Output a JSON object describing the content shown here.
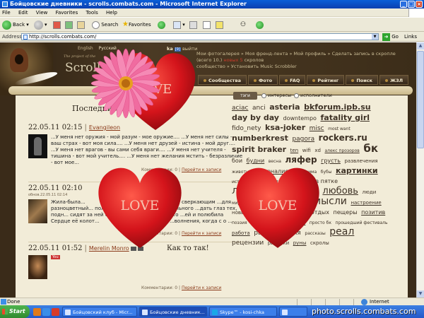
{
  "window": {
    "title": "Бойцовские дневники - scrolls.combats.com - Microsoft Internet Explorer"
  },
  "menu": [
    "File",
    "Edit",
    "View",
    "Favorites",
    "Tools",
    "Help"
  ],
  "toolbar": {
    "back": "Back",
    "search": "Search",
    "favorites": "Favorites"
  },
  "address": {
    "label": "Address",
    "url": "http://scrolls.combats.com/",
    "go": "Go",
    "links": "Links"
  },
  "site": {
    "langs": {
      "en": "English",
      "ru": "Русский"
    },
    "tagline": "The project of the",
    "title": "Scrolls",
    "user": {
      "name": "ka",
      "badge": "[9]",
      "action": "выйти"
    },
    "nav_line1": "Мои фотогалерея » Моя френд-лента » Мой профиль » Сделать запись в скропле",
    "nav_line2": "(всего 10.)",
    "nav_new": "новых 5",
    "nav_scrolls": "скролов",
    "nav_line3": "сообщество » Установить Music Scrobbler",
    "tabs": [
      "Сообщества",
      "Фото",
      "FAQ",
      "Рейтинг",
      "Поиск",
      "ЖЗЛ"
    ]
  },
  "feed": {
    "section_title": "Последние записи",
    "posts": [
      {
        "date": "22.05.11 02:15",
        "author": "Evangileon",
        "text": "...У меня нет оружия - мой разум - мое оружие.... ...У меня нет силы - ваш страх - вот моя сила.... ...У меня нет друзей - истина - мой друг.... ...У меня нет врагов - вы сами себя враги.... ...У меня нет учителя - тишина - вот мой учитель.... ...У меня нет желания мстить - безразличие - вот мое...",
        "comments": "Комментарии: 0",
        "link": "Перейти к записи"
      },
      {
        "date": "22.05.11 02:10",
        "meta": "обнов.22.05.11 02:14",
        "text": "Жила-была... разноцветный... полёта в подн... сидят за ней с... Сердце её колот...",
        "text2": "...со сверкающим ...для вольного ...дать глаз тех, кто ...ей и полюбила ...волнения, когда с о ...",
        "comments": "Комментарии: 0",
        "link": "Перейти к записи"
      },
      {
        "date": "22.05.11 01:52",
        "author": "Merelin Monro",
        "title": "Как то так!",
        "yt": "You",
        "comments": "Комментарии: 0",
        "link": "Перейти к записи"
      }
    ]
  },
  "cloud": {
    "tabs": {
      "tags": "тэги",
      "interests": "интересы",
      "performers": "исполнители"
    },
    "tags": [
      {
        "t": "aciac",
        "s": 9
      },
      {
        "t": "anci",
        "s": 9
      },
      {
        "t": "asteria",
        "s": 11,
        "b": true
      },
      {
        "t": "bkforum.ipb.su",
        "s": 11,
        "b": true
      },
      {
        "t": "day by day",
        "s": 11,
        "b": true
      },
      {
        "t": "downtempo",
        "s": 8
      },
      {
        "t": "fatality girl",
        "s": 11,
        "b": true
      },
      {
        "t": "fido_nety",
        "s": 9
      },
      {
        "t": "ksa-joker",
        "s": 11,
        "b": true
      },
      {
        "t": "misc",
        "s": 9
      },
      {
        "t": "most want",
        "s": 6
      },
      {
        "t": "numberkrest",
        "s": 11,
        "b": true
      },
      {
        "t": "pagora",
        "s": 9
      },
      {
        "t": "rockers.ru",
        "s": 12,
        "b": true
      },
      {
        "t": "spirit braker",
        "s": 11,
        "b": true
      },
      {
        "t": "ten",
        "s": 7
      },
      {
        "t": "wifi",
        "s": 7
      },
      {
        "t": "xd",
        "s": 7
      },
      {
        "t": "алекс прозоров",
        "s": 6
      },
      {
        "t": "бк",
        "s": 15,
        "b": true
      },
      {
        "t": "бои",
        "s": 8
      },
      {
        "t": "будни",
        "s": 8
      },
      {
        "t": "весна",
        "s": 6
      },
      {
        "t": "ляфер",
        "s": 12,
        "b": true
      },
      {
        "t": "грусть",
        "s": 8
      },
      {
        "t": "развлечения",
        "s": 7
      },
      {
        "t": "животные",
        "s": 6
      },
      {
        "t": "журналистика",
        "s": 8
      },
      {
        "t": "зима",
        "s": 6
      },
      {
        "t": "бубы",
        "s": 6
      },
      {
        "t": "картинки",
        "s": 11,
        "b": true
      },
      {
        "t": "история",
        "s": 6
      },
      {
        "t": "nuckts",
        "s": 6
      },
      {
        "t": "клан",
        "s": 7
      },
      {
        "t": "колючка в пятке",
        "s": 8
      },
      {
        "t": "лишенная теней",
        "s": 14
      },
      {
        "t": "любовь",
        "s": 13
      },
      {
        "t": "люди",
        "s": 7
      },
      {
        "t": "мир",
        "s": 6
      },
      {
        "t": "мои мысли",
        "s": 7
      },
      {
        "t": "музыка",
        "s": 12
      },
      {
        "t": "мысли",
        "s": 14
      },
      {
        "t": "настроение",
        "s": 7
      },
      {
        "t": "новый год",
        "s": 7
      },
      {
        "t": "общение",
        "s": 7
      },
      {
        "t": "осень",
        "s": 8
      },
      {
        "t": "отдых",
        "s": 8
      },
      {
        "t": "пещеры",
        "s": 8
      },
      {
        "t": "позитив",
        "s": 8
      },
      {
        "t": "поэзия",
        "s": 6
      },
      {
        "t": "прикол",
        "s": 8
      },
      {
        "t": "приколы",
        "s": 9
      },
      {
        "t": "просто бк",
        "s": 6
      },
      {
        "t": "прошедший фестиваль",
        "s": 6
      },
      {
        "t": "работа",
        "s": 7
      },
      {
        "t": "размышления",
        "s": 9
      },
      {
        "t": "рассказы",
        "s": 6
      },
      {
        "t": "реал",
        "s": 14
      },
      {
        "t": "рецензии",
        "s": 9
      },
      {
        "t": "рисунки",
        "s": 7
      },
      {
        "t": "руны",
        "s": 7
      },
      {
        "t": "скролы",
        "s": 7
      }
    ]
  },
  "overlay": {
    "heart_text": "LOVE"
  },
  "status": {
    "done": "Done",
    "zone": "Internet"
  },
  "taskbar": {
    "start": "Start",
    "tasks": [
      "Бойцовский клуб - Micr...",
      "Бойцовские дневник...",
      "Skype™ - kosi-chka",
      ""
    ]
  },
  "watermark": "photo.scrolls.combats.com",
  "colors": {
    "titlebar": "#0a5fd8",
    "heart": "#d4141b",
    "flower": "#f06ca0",
    "parchment": "#f2ecd8"
  }
}
